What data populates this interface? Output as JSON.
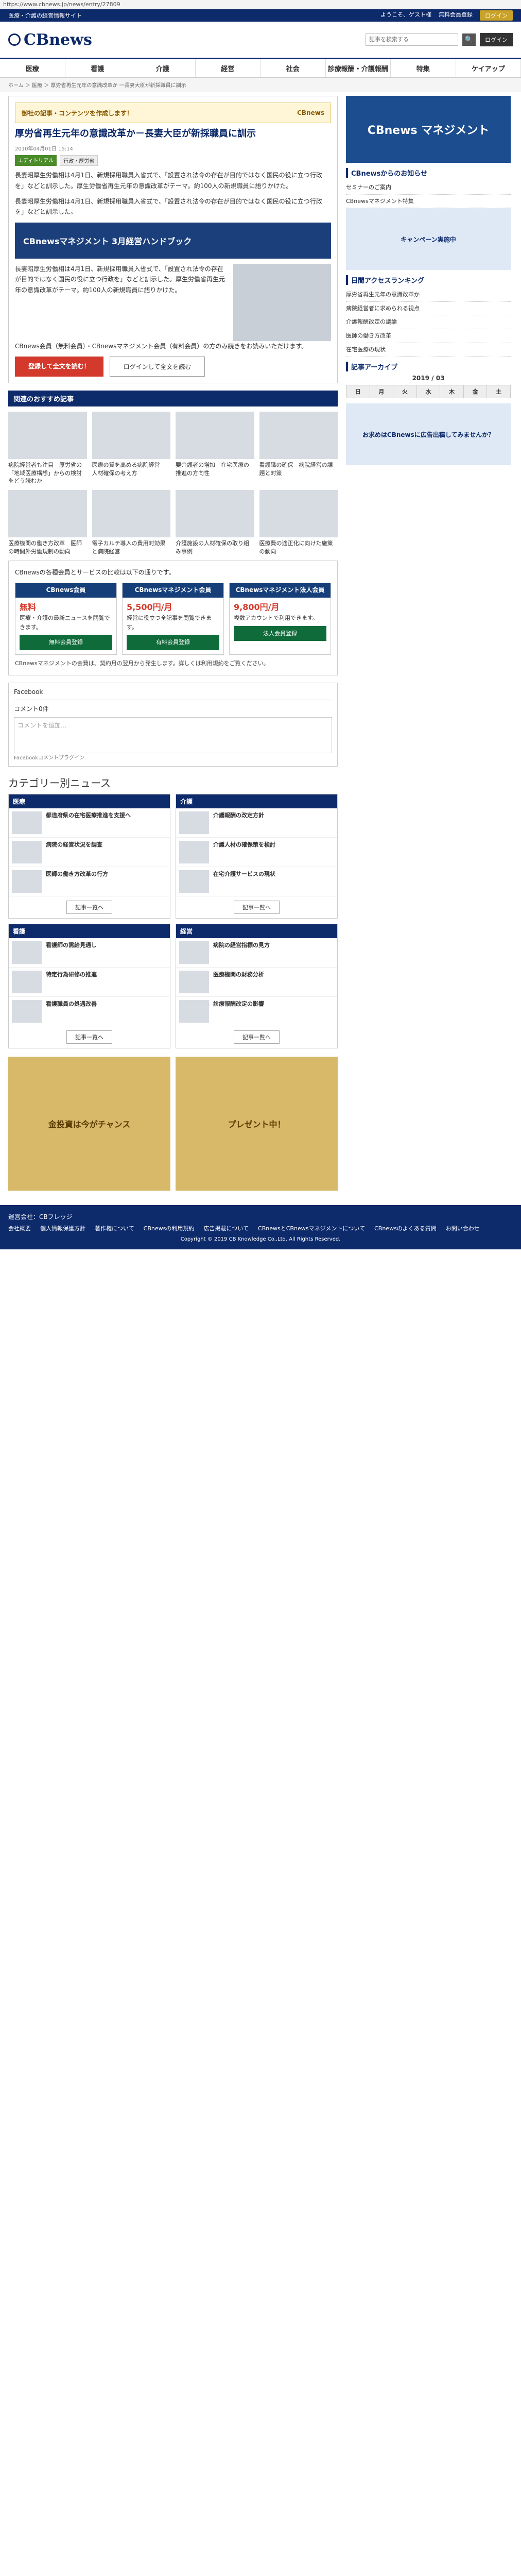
{
  "url": "https://www.cbnews.jp/news/entry/27809",
  "header": {
    "top_text": "医療・介護の経営情報サイト",
    "top_links": [
      "ようこそ、ゲスト様",
      "無料会員登録"
    ],
    "top_button": "ログイン",
    "logo": "CBnews",
    "search_placeholder": "記事を検索する",
    "login": "ログイン"
  },
  "nav": [
    "医療",
    "看護",
    "介護",
    "経営",
    "社会",
    "診療報酬・介護報酬",
    "特集",
    "ケイアップ"
  ],
  "breadcrumb": "ホーム ＞ 医療 ＞ 厚労省再生元年の意識改革か 一長妻大臣が新採職員に訓示",
  "article": {
    "banner": "御社の記事・コンテンツを作成します！",
    "banner_right": "CBnews",
    "title": "厚労省再生元年の意識改革か－長妻大臣が新採職員に訓示",
    "date": "2010年04月01日 15:14",
    "tags": [
      "エディトリアル",
      "行政・厚労省"
    ],
    "para1": "長妻昭厚生労働相は4月1日、新規採用職員入省式で、「設置され法令の存在が目的ではなく国民の役に立つ行政を」などと訓示した。厚生労働省再生元年の意識改革がテーマ。約100人の新規職員に語りかけた。",
    "para2": "長妻昭厚生労働相は4月1日、新規採用職員入省式で、「設置され法令の存在が目的ではなく国民の役に立つ行政を」などと訓示した。",
    "promo": "CBnewsマネジメント 3月経営ハンドブック",
    "para3": "長妻昭厚生労働相は4月1日、新規採用職員入省式で、「設置され法令の存在が目的ではなく国民の役に立つ行政を」などと訓示した。厚生労働省再生元年の意識改革がテーマ。約100人の新規職員に語りかけた。",
    "para4": "CBnews会員（無料会員）・CBnewsマネジメント会員（有料会員）の方のみ続きをお読みいただけます。",
    "cta_register": "登録して全文を読む！",
    "cta_login": "ログインして全文を読む"
  },
  "related": {
    "title": "関連のおすすめ記事",
    "cards": [
      "病院経営者も注目　厚労省の「地域医療構想」からの検討をどう読むか",
      "医療の質を高める病院経営　人材確保の考え方",
      "要介護者の増加　在宅医療の推進の方向性",
      "看護職の確保　病院経営の課題と対策",
      "医療機関の働き方改革　医師の時間外労働規制の動向",
      "電子カルテ導入の費用対効果と病院経営",
      "介護施設の人材確保の取り組み事例",
      "医療費の適正化に向けた施策の動向"
    ]
  },
  "plans": {
    "intro": "CBnewsの各種会員とサービスの比較は以下の通りです。",
    "items": [
      {
        "name": "CBnews会員",
        "price": "無料",
        "desc": "医療・介護の最新ニュースを閲覧できます。",
        "button": "無料会員登録"
      },
      {
        "name": "CBnewsマネジメント会員",
        "price": "5,500円/月",
        "desc": "経営に役立つ全記事を閲覧できます。",
        "button": "有料会員登録"
      },
      {
        "name": "CBnewsマネジメント法人会員",
        "price": "9,800円/月",
        "desc": "複数アカウントで利用できます。",
        "button": "法人会員登録"
      }
    ],
    "note": "CBnewsマネジメントの会費は、契約月の翌月から発生します。詳しくは利用規約をご覧ください。"
  },
  "fb": {
    "title": "Facebook",
    "comments_label": "コメント0件",
    "comment_placeholder": "コメントを追加...",
    "plugin": "Facebookコメントプラグイン"
  },
  "categories": {
    "title": "カテゴリー別ニュース",
    "blocks": [
      {
        "name": "医療",
        "items": [
          "都道府県の在宅医療推進を支援へ",
          "病院の経営状況を調査",
          "医師の働き方改革の行方"
        ]
      },
      {
        "name": "介護",
        "items": [
          "介護報酬の改定方針",
          "介護人材の確保策を検討",
          "在宅介護サービスの現状"
        ]
      },
      {
        "name": "看護",
        "items": [
          "看護師の需給見通し",
          "特定行為研修の推進",
          "看護職員の処遇改善"
        ]
      },
      {
        "name": "経営",
        "items": [
          "病院の経営指標の見方",
          "医療機関の財務分析",
          "診療報酬改定の影響"
        ]
      }
    ],
    "more": "記事一覧へ"
  },
  "ads": [
    "金投資は今がチャンス",
    "プレゼント中！"
  ],
  "sidebar": {
    "banner": "CBnews マネジメント",
    "events_title": "CBnewsからのお知らせ",
    "events": [
      "セミナーのご案内",
      "CBnewsマネジメント特集"
    ],
    "rank_title": "日間アクセスランキング",
    "ranking": [
      "厚労省再生元年の意識改革か",
      "病院経営者に求められる視点",
      "介護報酬改定の議論",
      "医師の働き方改革",
      "在宅医療の現状"
    ],
    "archive_title": "記事アーカイブ",
    "calendar_label": "2019 / 03",
    "weekdays": [
      "日",
      "月",
      "火",
      "水",
      "木",
      "金",
      "土"
    ],
    "ad1": "キャンペーン実施中",
    "ad2": "お求めはCBnewsに広告出稿してみませんか？"
  },
  "footer": {
    "company": "運営会社：CBフレッジ",
    "links": [
      "会社概要",
      "個人情報保護方針",
      "著作権について",
      "CBnewsの利用規約",
      "広告掲載について",
      "CBnewsとCBnewsマネジメントについて",
      "CBnewsのよくある質問",
      "お問い合わせ"
    ],
    "copyright": "Copyright © 2019 CB Knowledge Co.,Ltd. All Rights Reserved."
  }
}
